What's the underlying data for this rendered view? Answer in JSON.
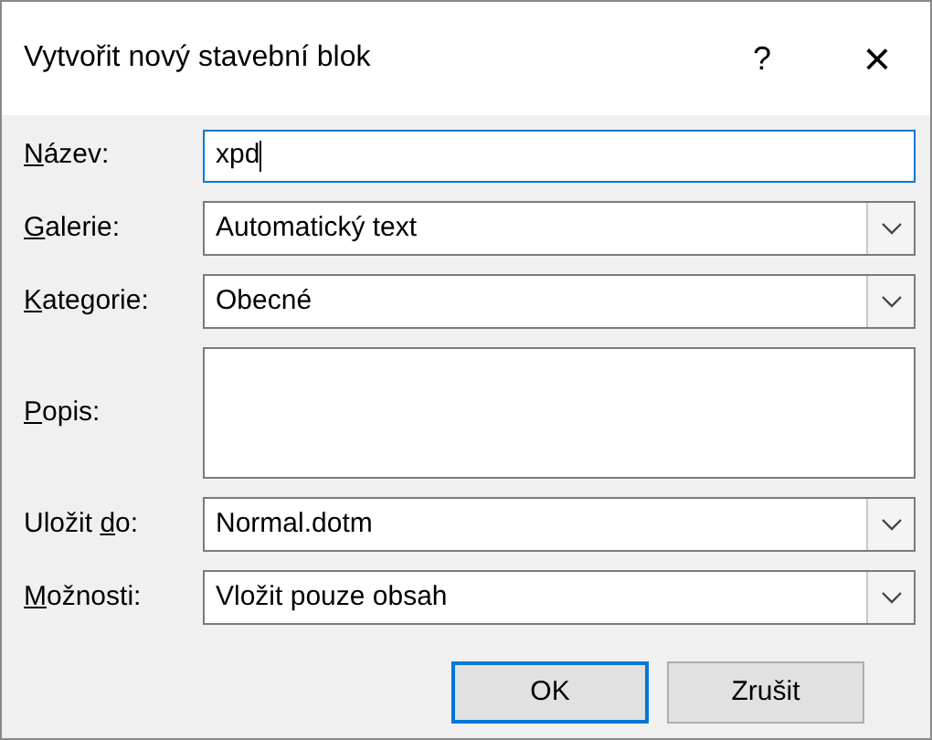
{
  "window": {
    "title": "Vytvořit nový stavební blok",
    "help": "?",
    "close": "×"
  },
  "fields": [
    {
      "kind": "text",
      "label": {
        "key": "N",
        "after": "ázev:"
      },
      "value": "xpd",
      "focused": true
    },
    {
      "kind": "combo",
      "label": {
        "key": "G",
        "after": "alerie:"
      },
      "value": "Automatický text"
    },
    {
      "kind": "combo",
      "label": {
        "key": "K",
        "after": "ategorie:"
      },
      "value": "Obecné"
    },
    {
      "kind": "textarea",
      "label": {
        "key": "P",
        "after": "opis:"
      }
    },
    {
      "kind": "combo",
      "label": {
        "before": "Uložit ",
        "key": "d",
        "after": "o:"
      },
      "value": "Normal.dotm"
    },
    {
      "kind": "combo",
      "label": {
        "key": "M",
        "after": "ožnosti:"
      },
      "value": "Vložit pouze obsah"
    }
  ],
  "buttons": [
    {
      "label": "OK",
      "default": true
    },
    {
      "label": "Zrušit",
      "default": false
    }
  ]
}
